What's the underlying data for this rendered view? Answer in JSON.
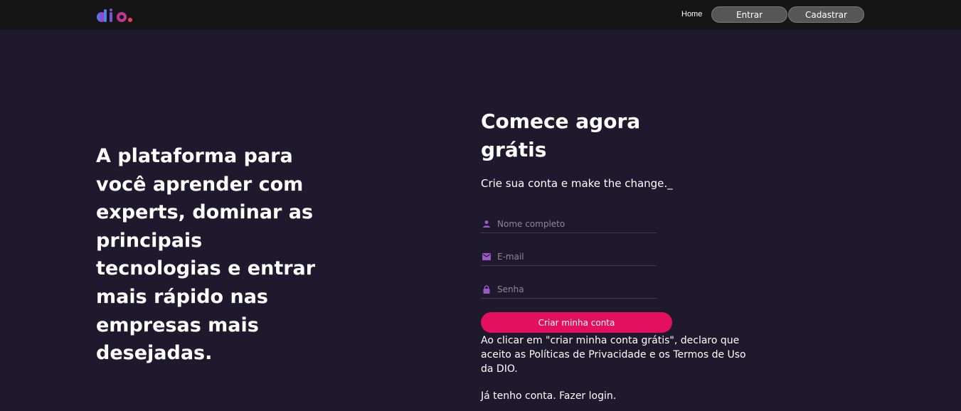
{
  "header": {
    "logo_text": "dio.",
    "nav": {
      "home_label": "Home",
      "entrar_label": "Entrar",
      "cadastrar_label": "Cadastrar"
    }
  },
  "hero": {
    "title": "A plataforma para você aprender com experts, dominar as principais tecnologias e entrar mais rápido nas empresas mais desejadas."
  },
  "signup": {
    "title": "Comece agora grátis",
    "subtitle": "Crie sua conta e make the change._",
    "fields": {
      "name": {
        "placeholder": "Nome completo",
        "icon": "person-icon"
      },
      "email": {
        "placeholder": "E-mail",
        "icon": "mail-icon"
      },
      "password": {
        "placeholder": "Senha",
        "icon": "lock-icon"
      }
    },
    "submit_label": "Criar minha conta",
    "terms_text": "Ao clicar em \"criar minha conta grátis\", declaro que aceito as Políticas de Privacidade e os Termos de Uso da DIO.",
    "login_text": "Já tenho conta. Fazer login."
  },
  "colors": {
    "background": "#1e192c",
    "header": "#151515",
    "accent": "#e4105d",
    "icon": "#9b59c9"
  }
}
